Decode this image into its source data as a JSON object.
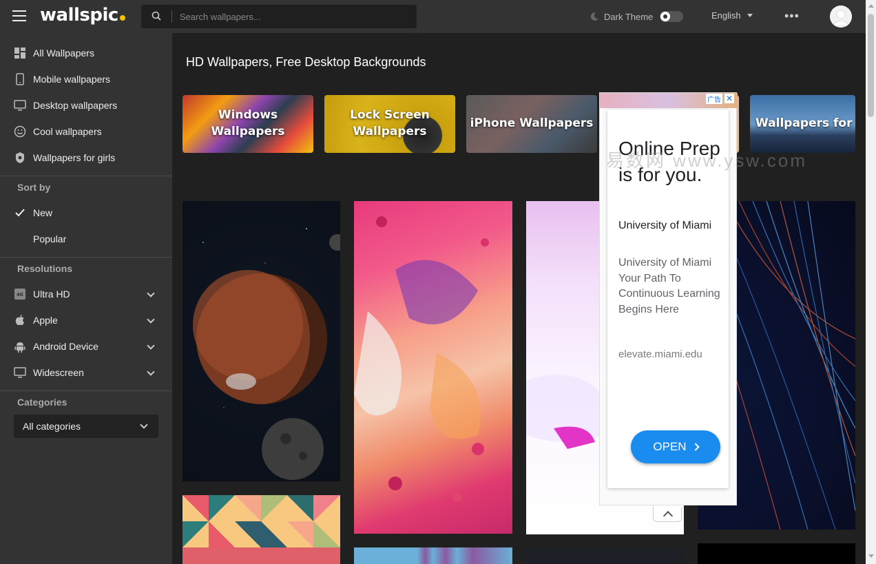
{
  "header": {
    "logo": "wallspic",
    "search_placeholder": "Search wallpapers...",
    "dark_theme_label": "Dark Theme",
    "language": "English",
    "more": "•••"
  },
  "sidebar": {
    "items": [
      {
        "label": "All Wallpapers",
        "icon": "grid-icon"
      },
      {
        "label": "Mobile wallpapers",
        "icon": "phone-icon"
      },
      {
        "label": "Desktop wallpapers",
        "icon": "monitor-icon"
      },
      {
        "label": "Cool wallpapers",
        "icon": "smiley-icon"
      },
      {
        "label": "Wallpapers for girls",
        "icon": "flower-icon"
      }
    ],
    "sort_title": "Sort by",
    "sort": [
      {
        "label": "New",
        "selected": true
      },
      {
        "label": "Popular",
        "selected": false
      }
    ],
    "resolutions_title": "Resolutions",
    "resolutions": [
      {
        "label": "Ultra HD",
        "icon": "4k-icon"
      },
      {
        "label": "Apple",
        "icon": "apple-icon"
      },
      {
        "label": "Android Device",
        "icon": "android-icon"
      },
      {
        "label": "Widescreen",
        "icon": "monitor-icon"
      }
    ],
    "categories_title": "Categories",
    "categories_selected": "All categories"
  },
  "main": {
    "title": "HD Wallpapers, Free Desktop Backgrounds",
    "category_cards": [
      {
        "label": "Windows Wallpapers"
      },
      {
        "label": "Lock Screen Wallpapers"
      },
      {
        "label": "iPhone Wallpapers"
      },
      {
        "label": ""
      },
      {
        "label": "Wallpapers for b"
      }
    ]
  },
  "ad": {
    "tag": "广告",
    "close": "✕",
    "headline": "Online Prep is for you.",
    "advertiser": "University of Miami",
    "description": "University of Miami Your Path To Continuous Learning Begins Here",
    "url": "elevate.miami.edu",
    "button": "OPEN"
  },
  "watermark": "易数网 www.ysw.com"
}
